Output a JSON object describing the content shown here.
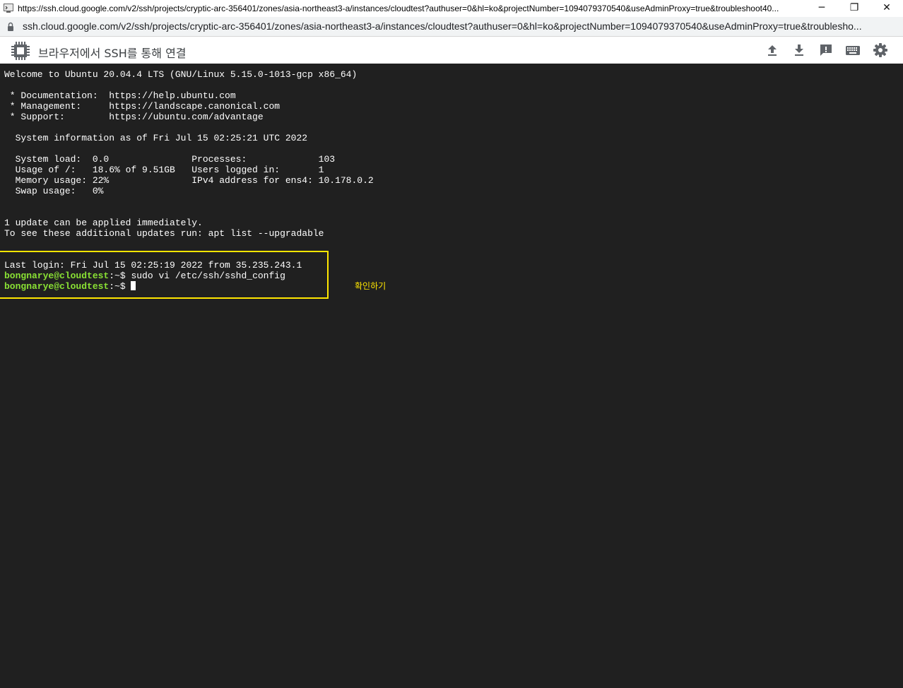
{
  "window": {
    "title": "https://ssh.cloud.google.com/v2/ssh/projects/cryptic-arc-356401/zones/asia-northeast3-a/instances/cloudtest?authuser=0&hl=ko&projectNumber=1094079370540&useAdminProxy=true&troubleshoot40...",
    "minimize": "─",
    "restore": "❐",
    "close": "✕"
  },
  "address": {
    "url": "ssh.cloud.google.com/v2/ssh/projects/cryptic-arc-356401/zones/asia-northeast3-a/instances/cloudtest?authuser=0&hl=ko&projectNumber=1094079370540&useAdminProxy=true&troublesho..."
  },
  "toolbar": {
    "title": "브라우저에서 SSH를 통해 연결",
    "icons": [
      "upload-icon",
      "download-icon",
      "feedback-icon",
      "keyboard-icon",
      "settings-icon"
    ]
  },
  "terminal": {
    "lines": [
      "Welcome to Ubuntu 20.04.4 LTS (GNU/Linux 5.15.0-1013-gcp x86_64)",
      "",
      " * Documentation:  https://help.ubuntu.com",
      " * Management:     https://landscape.canonical.com",
      " * Support:        https://ubuntu.com/advantage",
      "",
      "  System information as of Fri Jul 15 02:25:21 UTC 2022",
      "",
      "  System load:  0.0               Processes:             103",
      "  Usage of /:   18.6% of 9.51GB   Users logged in:       1",
      "  Memory usage: 22%               IPv4 address for ens4: 10.178.0.2",
      "  Swap usage:   0%",
      "",
      "",
      "1 update can be applied immediately.",
      "To see these additional updates run: apt list --upgradable",
      "",
      "",
      "Last login: Fri Jul 15 02:25:19 2022 from 35.235.243.1"
    ],
    "prompt_user": "bongnarye@cloudtest",
    "prompt_suffix": ":~$ ",
    "command": "sudo vi /etc/ssh/sshd_config"
  },
  "annotation": {
    "note": "확인하기",
    "color": "#ffe600"
  },
  "colors": {
    "terminal_bg": "#202020",
    "prompt_green": "#8ae234"
  }
}
